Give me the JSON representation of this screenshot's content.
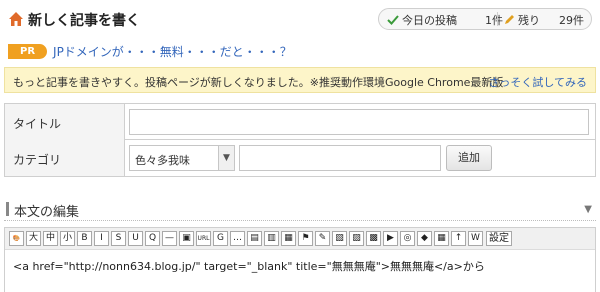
{
  "header": {
    "title": "新しく記事を書く",
    "stats": {
      "today_label": "今日の投稿",
      "today_value": "1件",
      "remaining_label": "残り",
      "remaining_value": "29件"
    }
  },
  "pr": {
    "badge": "PR",
    "text": "JPドメインが・・・無料・・・だと・・・？"
  },
  "notice": {
    "text": "もっと記事を書きやすく。投稿ページが新しくなりました。※推奨動作環境Google Chrome最新版",
    "link": "さっそく試してみる"
  },
  "form": {
    "title_label": "タイトル",
    "title_value": "",
    "category_label": "カテゴリ",
    "category_selected": "色々多我味",
    "category_new_value": "",
    "add_button": "追加"
  },
  "editor": {
    "section_title": "本文の編集",
    "toolbar": [
      {
        "name": "palette-icon",
        "glyph": "🎨"
      },
      {
        "name": "font-large-button",
        "glyph": "大"
      },
      {
        "name": "font-medium-button",
        "glyph": "中"
      },
      {
        "name": "font-small-button",
        "glyph": "小"
      },
      {
        "name": "bold-button",
        "glyph": "B"
      },
      {
        "name": "italic-button",
        "glyph": "I"
      },
      {
        "name": "strike-button",
        "glyph": "S"
      },
      {
        "name": "underline-button",
        "glyph": "U"
      },
      {
        "name": "quote-button",
        "glyph": "Q"
      },
      {
        "name": "hr-button",
        "glyph": "—"
      },
      {
        "name": "image-icon",
        "glyph": "▣"
      },
      {
        "name": "url-icon",
        "glyph": "URL"
      },
      {
        "name": "google-icon",
        "glyph": "G"
      },
      {
        "name": "more-icon",
        "glyph": "…"
      },
      {
        "name": "doc-icon",
        "glyph": "▤"
      },
      {
        "name": "doc2-icon",
        "glyph": "▥"
      },
      {
        "name": "doc3-icon",
        "glyph": "▦"
      },
      {
        "name": "flag-icon",
        "glyph": "⚑"
      },
      {
        "name": "pencil-icon",
        "glyph": "✎"
      },
      {
        "name": "map-icon",
        "glyph": "▧"
      },
      {
        "name": "movie-icon",
        "glyph": "▨"
      },
      {
        "name": "tv-icon",
        "glyph": "▩"
      },
      {
        "name": "youtube-icon",
        "glyph": "▶"
      },
      {
        "name": "instagram-icon",
        "glyph": "◎"
      },
      {
        "name": "evernote-icon",
        "glyph": "◆"
      },
      {
        "name": "table-icon",
        "glyph": "▦"
      },
      {
        "name": "upload-icon",
        "glyph": "↑"
      },
      {
        "name": "wikipedia-icon",
        "glyph": "W"
      }
    ],
    "settings_button": "設定",
    "body_text": "<a href=\"http://nonn634.blog.jp/\" target=\"_blank\" title=\"無無無庵\">無無無庵</a>から"
  }
}
